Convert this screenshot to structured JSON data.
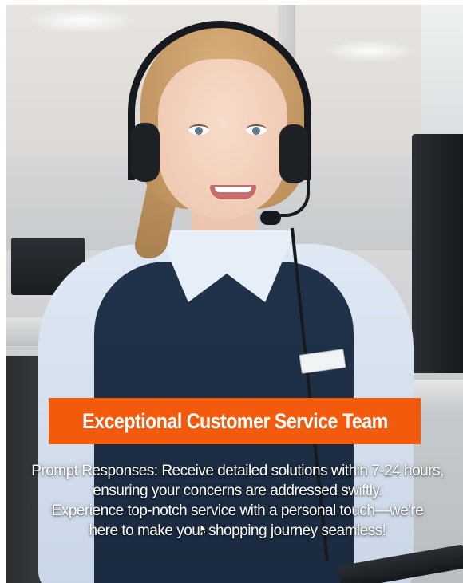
{
  "banner": {
    "title": "Exceptional Customer Service Team",
    "background_color": "#f45a0b",
    "text_color": "#ffffff"
  },
  "description": {
    "line1": "Prompt Responses: Receive detailed solutions within 7-24 hours,",
    "line2": "ensuring your concerns are addressed swiftly.",
    "line3": "Experience top-notch service with a personal touch—we're",
    "line4": "here to make your shopping journey seamless!"
  },
  "image": {
    "subject_icon": "customer-service-agent-photo",
    "cursor_icon": "mouse-pointer-icon"
  }
}
